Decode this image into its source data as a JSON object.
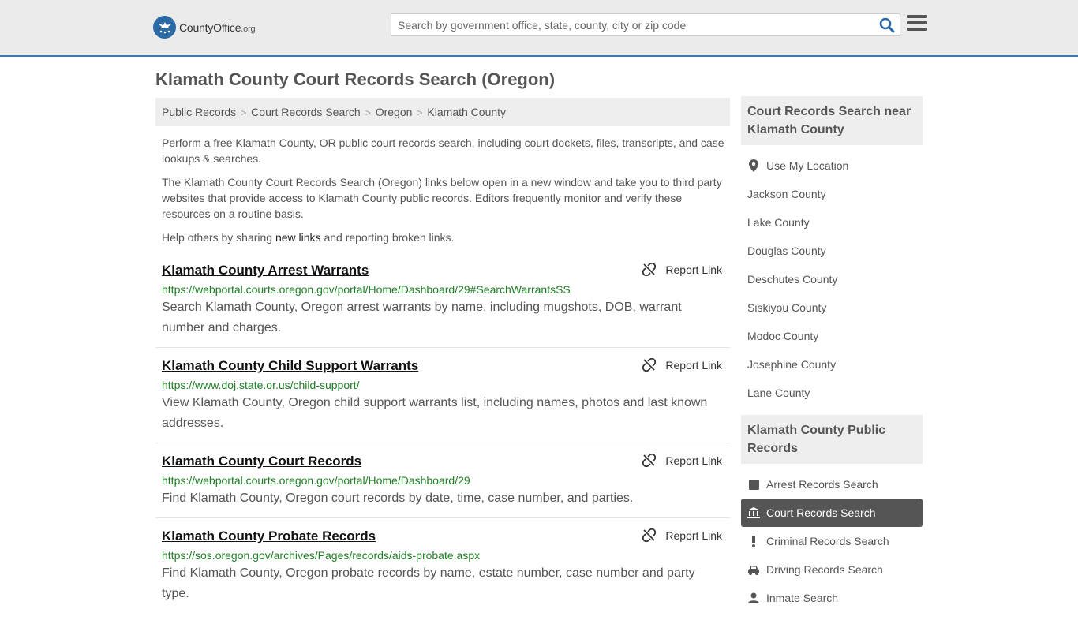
{
  "header": {
    "logo": {
      "county": "County",
      "office": "Office",
      "org": ".org"
    },
    "search_placeholder": "Search by government office, state, county, city or zip code",
    "search_icon": "search-icon",
    "menu_icon": "hamburger-menu-icon"
  },
  "page_title": "Klamath County Court Records Search (Oregon)",
  "breadcrumb": [
    "Public Records",
    "Court Records Search",
    "Oregon",
    "Klamath County"
  ],
  "intro": {
    "p1": "Perform a free Klamath County, OR public court records search, including court dockets, files, transcripts, and case lookups & searches.",
    "p2": "The Klamath County Court Records Search (Oregon) links below open in a new window and take you to third party websites that provide access to Klamath County public records. Editors frequently monitor and verify these resources on a routine basis.",
    "p3_before": "Help others by sharing ",
    "p3_link": "new links",
    "p3_after": " and reporting broken links."
  },
  "report_label": "Report Link",
  "links": [
    {
      "title": "Klamath County Arrest Warrants",
      "url": "https://webportal.courts.oregon.gov/portal/Home/Dashboard/29#SearchWarrantsSS",
      "desc": "Search Klamath County, Oregon arrest warrants by name, including mugshots, DOB, warrant number and charges."
    },
    {
      "title": "Klamath County Child Support Warrants",
      "url": "https://www.doj.state.or.us/child-support/",
      "desc": "View Klamath County, Oregon child support warrants list, including names, photos and last known addresses."
    },
    {
      "title": "Klamath County Court Records",
      "url": "https://webportal.courts.oregon.gov/portal/Home/Dashboard/29",
      "desc": "Find Klamath County, Oregon court records by date, time, case number, and parties."
    },
    {
      "title": "Klamath County Probate Records",
      "url": "https://sos.oregon.gov/archives/Pages/records/aids-probate.aspx",
      "desc": "Find Klamath County, Oregon probate records by name, estate number, case number and party type."
    }
  ],
  "sidebar": {
    "nearby": {
      "heading": "Court Records Search near Klamath County",
      "use_location": "Use My Location",
      "counties": [
        "Jackson County",
        "Lake County",
        "Douglas County",
        "Deschutes County",
        "Siskiyou County",
        "Modoc County",
        "Josephine County",
        "Lane County"
      ]
    },
    "public_records": {
      "heading": "Klamath County Public Records",
      "items": [
        {
          "label": "Arrest Records Search",
          "icon": "square-icon",
          "active": false
        },
        {
          "label": "Court Records Search",
          "icon": "courthouse-icon",
          "active": true
        },
        {
          "label": "Criminal Records Search",
          "icon": "exclamation-icon",
          "active": false
        },
        {
          "label": "Driving Records Search",
          "icon": "car-icon",
          "active": false
        },
        {
          "label": "Inmate Search",
          "icon": "inmate-icon",
          "active": false
        }
      ]
    }
  }
}
